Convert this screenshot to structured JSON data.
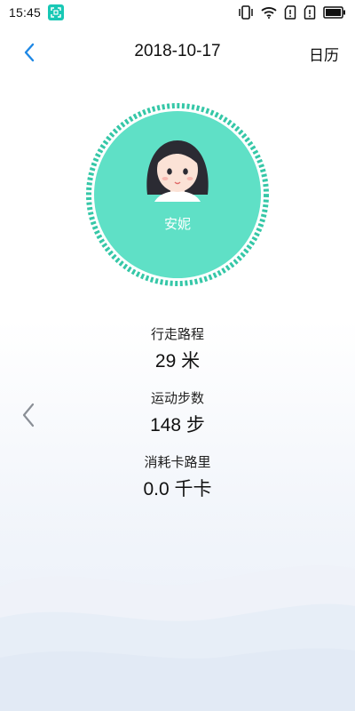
{
  "status_bar": {
    "time": "15:45",
    "icons": [
      "screenshot-app-icon",
      "vibrate-icon",
      "wifi-icon",
      "no-sim-icon",
      "no-sim-icon",
      "battery-icon"
    ]
  },
  "header": {
    "date": "2018-10-17",
    "calendar_label": "日历",
    "back_icon": "chevron-left-icon"
  },
  "profile": {
    "name": "安妮",
    "avatar": "girl-avatar",
    "circle_color": "#5fe0c6",
    "ring_color": "#35c7a7"
  },
  "stats": {
    "distance": {
      "label": "行走路程",
      "value": "29 米"
    },
    "steps": {
      "label": "运动步数",
      "value": "148 步"
    },
    "calories": {
      "label": "消耗卡路里",
      "value": "0.0 千卡"
    }
  },
  "nav": {
    "prev_icon": "chevron-left-icon"
  },
  "colors": {
    "accent": "#1e88e5",
    "teal": "#5fe0c6"
  }
}
